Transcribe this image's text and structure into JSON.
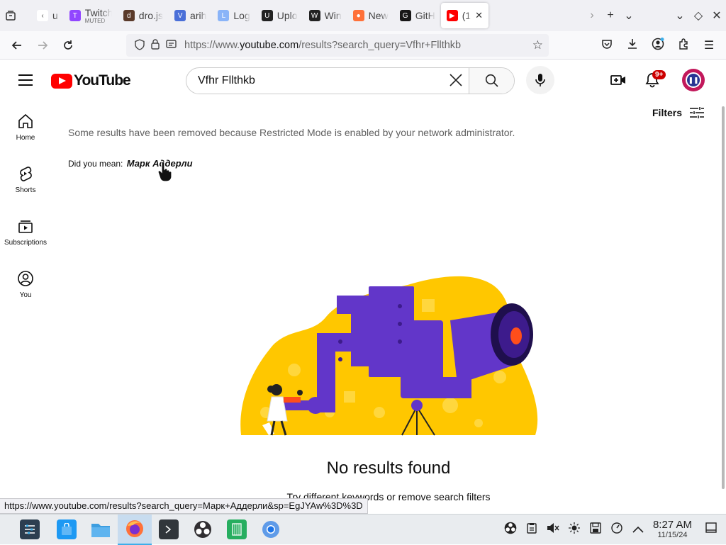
{
  "browser": {
    "tabs": [
      {
        "label": "u",
        "fav": "‹",
        "color": "#ffffff",
        "fg": "#555555"
      },
      {
        "label": "Twitch",
        "sub": "MUTED",
        "fav": "T",
        "color": "#9146ff"
      },
      {
        "label": "dro.js",
        "fav": "d",
        "color": "#5a3a2a"
      },
      {
        "label": "arih",
        "fav": "V",
        "color": "#4a6fd8"
      },
      {
        "label": "Log",
        "fav": "L",
        "color": "#8ab4f8"
      },
      {
        "label": "Uplo",
        "fav": "U",
        "color": "#222222"
      },
      {
        "label": "Win",
        "fav": "W",
        "color": "#222222"
      },
      {
        "label": "New",
        "fav": "●",
        "color": "#ff7139"
      },
      {
        "label": "GitH",
        "fav": "G",
        "color": "#181717"
      },
      {
        "label": "(1",
        "fav": "▶",
        "color": "#ff0000",
        "active": true
      }
    ],
    "url_prefix": "https://www.",
    "url_domain": "youtube.com",
    "url_rest": "/results?search_query=Vfhr+Fllthkb",
    "status_url": "https://www.youtube.com/results?search_query=Марк+Аддерли&sp=EgJYAw%3D%3D"
  },
  "youtube": {
    "logo_text": "YouTube",
    "search_value": "Vfhr Fllthkb",
    "notification_count": "9+",
    "sidebar": [
      {
        "label": "Home",
        "icon": "home-icon"
      },
      {
        "label": "Shorts",
        "icon": "shorts-icon"
      },
      {
        "label": "Subscriptions",
        "icon": "subscriptions-icon"
      },
      {
        "label": "You",
        "icon": "you-icon"
      }
    ],
    "filters_label": "Filters",
    "notice": "Some results have been removed because Restricted Mode is enabled by your network administrator.",
    "did_you_mean_label": "Did you mean:",
    "suggestion": "Марк Аддерли",
    "no_results_title": "No results found",
    "no_results_hint": "Try different keywords or remove search filters"
  },
  "taskbar": {
    "apps": [
      "settings",
      "store",
      "files",
      "firefox",
      "terminal",
      "obs",
      "notes",
      "chromium"
    ],
    "time": "8:27 AM",
    "date": "11/15/24"
  },
  "colors": {
    "youtube_red": "#ff0000",
    "illustration_purple": "#6236c9",
    "illustration_yellow": "#ffc700"
  }
}
